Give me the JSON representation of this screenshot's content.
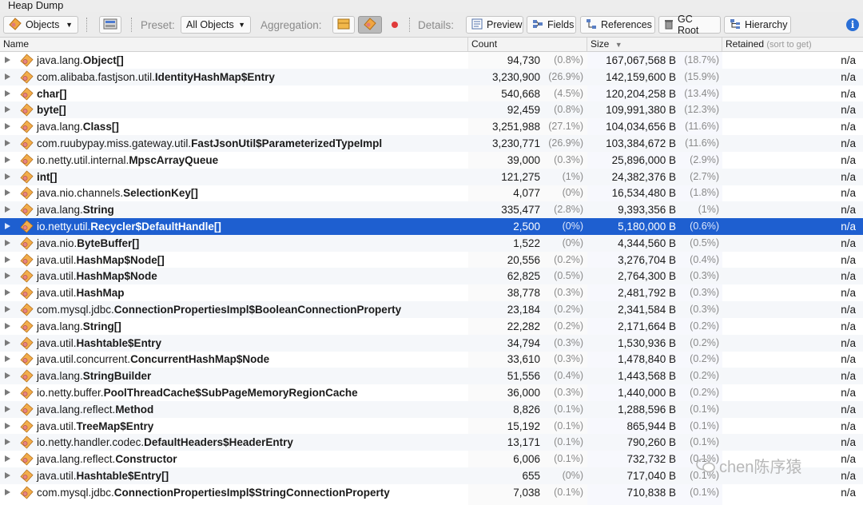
{
  "window": {
    "title": "Heap Dump"
  },
  "toolbar": {
    "objects_label": "Objects",
    "preset_label": "Preset:",
    "preset_value": "All Objects",
    "aggregation_label": "Aggregation:",
    "details_label": "Details:",
    "preview_label": "Preview",
    "fields_label": "Fields",
    "references_label": "References",
    "gcroot_label": "GC Root",
    "hierarchy_label": "Hierarchy"
  },
  "columns": {
    "name": "Name",
    "count": "Count",
    "size": "Size",
    "retained": "Retained",
    "retained_hint": "(sort to get)"
  },
  "rows": [
    {
      "prefix": "java.lang.",
      "cls": "Object[]",
      "count": "94,730",
      "count_pct": "(0.8%)",
      "size": "167,067,568 B",
      "size_pct": "(18.7%)",
      "retained": "n/a"
    },
    {
      "prefix": "com.alibaba.fastjson.util.",
      "cls": "IdentityHashMap$Entry",
      "count": "3,230,900",
      "count_pct": "(26.9%)",
      "size": "142,159,600 B",
      "size_pct": "(15.9%)",
      "retained": "n/a"
    },
    {
      "prefix": "",
      "cls": "char[]",
      "count": "540,668",
      "count_pct": "(4.5%)",
      "size": "120,204,258 B",
      "size_pct": "(13.4%)",
      "retained": "n/a"
    },
    {
      "prefix": "",
      "cls": "byte[]",
      "count": "92,459",
      "count_pct": "(0.8%)",
      "size": "109,991,380 B",
      "size_pct": "(12.3%)",
      "retained": "n/a"
    },
    {
      "prefix": "java.lang.",
      "cls": "Class[]",
      "count": "3,251,988",
      "count_pct": "(27.1%)",
      "size": "104,034,656 B",
      "size_pct": "(11.6%)",
      "retained": "n/a"
    },
    {
      "prefix": "com.ruubypay.miss.gateway.util.",
      "cls": "FastJsonUtil$ParameterizedTypeImpl",
      "count": "3,230,771",
      "count_pct": "(26.9%)",
      "size": "103,384,672 B",
      "size_pct": "(11.6%)",
      "retained": "n/a"
    },
    {
      "prefix": "io.netty.util.internal.",
      "cls": "MpscArrayQueue",
      "count": "39,000",
      "count_pct": "(0.3%)",
      "size": "25,896,000 B",
      "size_pct": "(2.9%)",
      "retained": "n/a"
    },
    {
      "prefix": "",
      "cls": "int[]",
      "count": "121,275",
      "count_pct": "(1%)",
      "size": "24,382,376 B",
      "size_pct": "(2.7%)",
      "retained": "n/a"
    },
    {
      "prefix": "java.nio.channels.",
      "cls": "SelectionKey[]",
      "count": "4,077",
      "count_pct": "(0%)",
      "size": "16,534,480 B",
      "size_pct": "(1.8%)",
      "retained": "n/a"
    },
    {
      "prefix": "java.lang.",
      "cls": "String",
      "count": "335,477",
      "count_pct": "(2.8%)",
      "size": "9,393,356 B",
      "size_pct": "(1%)",
      "retained": "n/a"
    },
    {
      "prefix": "io.netty.util.",
      "cls": "Recycler$DefaultHandle[]",
      "count": "2,500",
      "count_pct": "(0%)",
      "size": "5,180,000 B",
      "size_pct": "(0.6%)",
      "retained": "n/a"
    },
    {
      "prefix": "java.nio.",
      "cls": "ByteBuffer[]",
      "count": "1,522",
      "count_pct": "(0%)",
      "size": "4,344,560 B",
      "size_pct": "(0.5%)",
      "retained": "n/a"
    },
    {
      "prefix": "java.util.",
      "cls": "HashMap$Node[]",
      "count": "20,556",
      "count_pct": "(0.2%)",
      "size": "3,276,704 B",
      "size_pct": "(0.4%)",
      "retained": "n/a"
    },
    {
      "prefix": "java.util.",
      "cls": "HashMap$Node",
      "count": "62,825",
      "count_pct": "(0.5%)",
      "size": "2,764,300 B",
      "size_pct": "(0.3%)",
      "retained": "n/a"
    },
    {
      "prefix": "java.util.",
      "cls": "HashMap",
      "count": "38,778",
      "count_pct": "(0.3%)",
      "size": "2,481,792 B",
      "size_pct": "(0.3%)",
      "retained": "n/a"
    },
    {
      "prefix": "com.mysql.jdbc.",
      "cls": "ConnectionPropertiesImpl$BooleanConnectionProperty",
      "count": "23,184",
      "count_pct": "(0.2%)",
      "size": "2,341,584 B",
      "size_pct": "(0.3%)",
      "retained": "n/a"
    },
    {
      "prefix": "java.lang.",
      "cls": "String[]",
      "count": "22,282",
      "count_pct": "(0.2%)",
      "size": "2,171,664 B",
      "size_pct": "(0.2%)",
      "retained": "n/a"
    },
    {
      "prefix": "java.util.",
      "cls": "Hashtable$Entry",
      "count": "34,794",
      "count_pct": "(0.3%)",
      "size": "1,530,936 B",
      "size_pct": "(0.2%)",
      "retained": "n/a"
    },
    {
      "prefix": "java.util.concurrent.",
      "cls": "ConcurrentHashMap$Node",
      "count": "33,610",
      "count_pct": "(0.3%)",
      "size": "1,478,840 B",
      "size_pct": "(0.2%)",
      "retained": "n/a"
    },
    {
      "prefix": "java.lang.",
      "cls": "StringBuilder",
      "count": "51,556",
      "count_pct": "(0.4%)",
      "size": "1,443,568 B",
      "size_pct": "(0.2%)",
      "retained": "n/a"
    },
    {
      "prefix": "io.netty.buffer.",
      "cls": "PoolThreadCache$SubPageMemoryRegionCache",
      "count": "36,000",
      "count_pct": "(0.3%)",
      "size": "1,440,000 B",
      "size_pct": "(0.2%)",
      "retained": "n/a"
    },
    {
      "prefix": "java.lang.reflect.",
      "cls": "Method",
      "count": "8,826",
      "count_pct": "(0.1%)",
      "size": "1,288,596 B",
      "size_pct": "(0.1%)",
      "retained": "n/a"
    },
    {
      "prefix": "java.util.",
      "cls": "TreeMap$Entry",
      "count": "15,192",
      "count_pct": "(0.1%)",
      "size": "865,944 B",
      "size_pct": "(0.1%)",
      "retained": "n/a"
    },
    {
      "prefix": "io.netty.handler.codec.",
      "cls": "DefaultHeaders$HeaderEntry",
      "count": "13,171",
      "count_pct": "(0.1%)",
      "size": "790,260 B",
      "size_pct": "(0.1%)",
      "retained": "n/a"
    },
    {
      "prefix": "java.lang.reflect.",
      "cls": "Constructor",
      "count": "6,006",
      "count_pct": "(0.1%)",
      "size": "732,732 B",
      "size_pct": "(0.1%)",
      "retained": "n/a"
    },
    {
      "prefix": "java.util.",
      "cls": "Hashtable$Entry[]",
      "count": "655",
      "count_pct": "(0%)",
      "size": "717,040 B",
      "size_pct": "(0.1%)",
      "retained": "n/a"
    },
    {
      "prefix": "com.mysql.jdbc.",
      "cls": "ConnectionPropertiesImpl$StringConnectionProperty",
      "count": "7,038",
      "count_pct": "(0.1%)",
      "size": "710,838 B",
      "size_pct": "(0.1%)",
      "retained": "n/a"
    }
  ],
  "selected_row": 10,
  "watermark": "chen陈序猿",
  "colors": {
    "selection": "#1e5fd0",
    "accent_info": "#2a6fd6"
  }
}
